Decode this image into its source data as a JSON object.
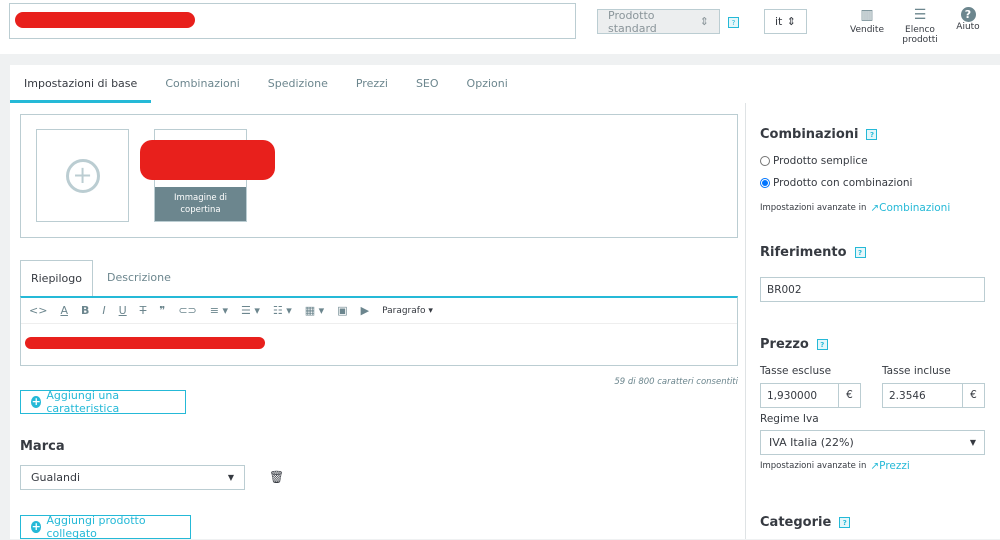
{
  "header": {
    "product_type": "Prodotto standard",
    "language": "it",
    "actions": [
      {
        "label": "Vendite",
        "icon": "chart-icon"
      },
      {
        "label": "Elenco prodotti",
        "icon": "list-icon"
      },
      {
        "label": "Aiuto",
        "icon": "help-icon"
      }
    ]
  },
  "tabs": [
    "Impostazioni di base",
    "Combinazioni",
    "Spedizione",
    "Prezzi",
    "SEO",
    "Opzioni"
  ],
  "images": {
    "cover_label": "Immagine di copertina"
  },
  "editor": {
    "tabs": [
      "Riepilogo",
      "Descrizione"
    ],
    "format": "Paragrafo",
    "counter": "59 di 800 caratteri consentiti"
  },
  "add_feature": "Aggiungi una caratteristica",
  "brand": {
    "title": "Marca",
    "value": "Gualandi"
  },
  "add_related": "Aggiungi prodotto collegato",
  "side": {
    "combinations": {
      "title": "Combinazioni",
      "options": [
        "Prodotto semplice",
        "Prodotto con combinazioni"
      ],
      "selected": 1,
      "advanced": "Impostazioni avanzate in",
      "link": "Combinazioni"
    },
    "reference": {
      "title": "Riferimento",
      "value": "BR002"
    },
    "price": {
      "title": "Prezzo",
      "excl_label": "Tasse escluse",
      "excl_value": "1,930000",
      "incl_label": "Tasse incluse",
      "incl_value": "2.3546",
      "currency": "€",
      "tax_label": "Regime Iva",
      "tax_value": "IVA Italia (22%)",
      "advanced": "Impostazioni avanzate in",
      "link": "Prezzi"
    },
    "categories": {
      "title": "Categorie"
    }
  },
  "colors": {
    "accent": "#25b9d7",
    "redaction": "#e8201c"
  }
}
